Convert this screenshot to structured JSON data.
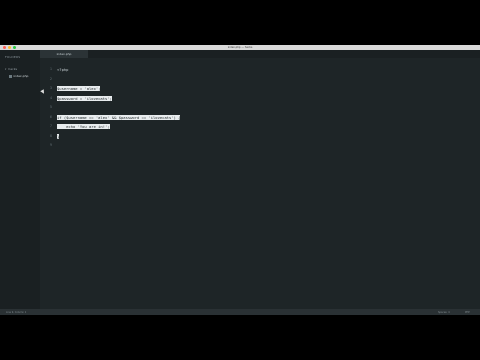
{
  "window": {
    "title": "index.php — hacks"
  },
  "sidebar": {
    "header": "FOLDERS",
    "folder": "hacks",
    "file": "index.php"
  },
  "tabs": [
    {
      "label": "index.php"
    }
  ],
  "editor": {
    "line_numbers": [
      "1",
      "2",
      "3",
      "4",
      "5",
      "6",
      "7",
      "8",
      "9"
    ],
    "lines": [
      "<?php",
      "",
      "$username = 'alex';",
      "$password = 'ilovecats';",
      "",
      "if ($username == 'alex' && $password == 'ilovecats') {",
      "    echo 'You are in!';",
      "}",
      ""
    ]
  },
  "statusbar": {
    "left": "Line 9, Column 1",
    "right_1": "Spaces: 4",
    "right_2": "PHP"
  },
  "colors": {
    "editor_bg": "#1e2527",
    "sidebar_bg": "#1a2022",
    "highlight": "#e8ecee"
  }
}
